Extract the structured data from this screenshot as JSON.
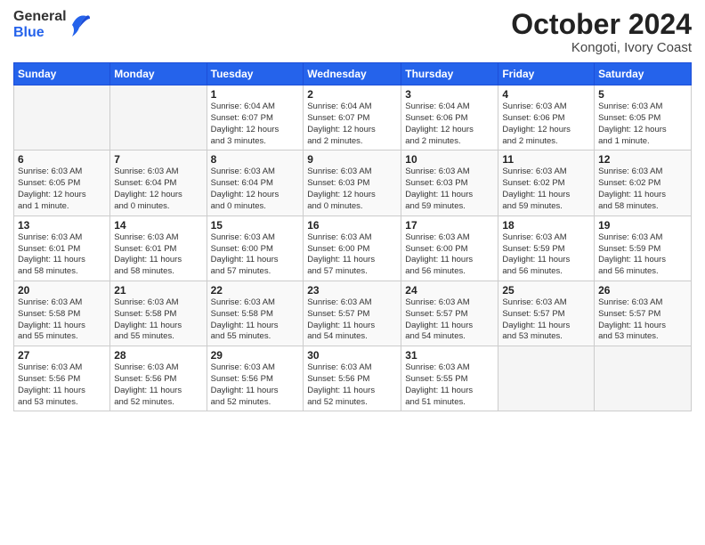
{
  "header": {
    "logo": {
      "general": "General",
      "blue": "Blue"
    },
    "title": "October 2024",
    "subtitle": "Kongoti, Ivory Coast"
  },
  "days_of_week": [
    "Sunday",
    "Monday",
    "Tuesday",
    "Wednesday",
    "Thursday",
    "Friday",
    "Saturday"
  ],
  "weeks": [
    [
      {
        "day": "",
        "info": ""
      },
      {
        "day": "",
        "info": ""
      },
      {
        "day": "1",
        "info": "Sunrise: 6:04 AM\nSunset: 6:07 PM\nDaylight: 12 hours\nand 3 minutes."
      },
      {
        "day": "2",
        "info": "Sunrise: 6:04 AM\nSunset: 6:07 PM\nDaylight: 12 hours\nand 2 minutes."
      },
      {
        "day": "3",
        "info": "Sunrise: 6:04 AM\nSunset: 6:06 PM\nDaylight: 12 hours\nand 2 minutes."
      },
      {
        "day": "4",
        "info": "Sunrise: 6:03 AM\nSunset: 6:06 PM\nDaylight: 12 hours\nand 2 minutes."
      },
      {
        "day": "5",
        "info": "Sunrise: 6:03 AM\nSunset: 6:05 PM\nDaylight: 12 hours\nand 1 minute."
      }
    ],
    [
      {
        "day": "6",
        "info": "Sunrise: 6:03 AM\nSunset: 6:05 PM\nDaylight: 12 hours\nand 1 minute."
      },
      {
        "day": "7",
        "info": "Sunrise: 6:03 AM\nSunset: 6:04 PM\nDaylight: 12 hours\nand 0 minutes."
      },
      {
        "day": "8",
        "info": "Sunrise: 6:03 AM\nSunset: 6:04 PM\nDaylight: 12 hours\nand 0 minutes."
      },
      {
        "day": "9",
        "info": "Sunrise: 6:03 AM\nSunset: 6:03 PM\nDaylight: 12 hours\nand 0 minutes."
      },
      {
        "day": "10",
        "info": "Sunrise: 6:03 AM\nSunset: 6:03 PM\nDaylight: 11 hours\nand 59 minutes."
      },
      {
        "day": "11",
        "info": "Sunrise: 6:03 AM\nSunset: 6:02 PM\nDaylight: 11 hours\nand 59 minutes."
      },
      {
        "day": "12",
        "info": "Sunrise: 6:03 AM\nSunset: 6:02 PM\nDaylight: 11 hours\nand 58 minutes."
      }
    ],
    [
      {
        "day": "13",
        "info": "Sunrise: 6:03 AM\nSunset: 6:01 PM\nDaylight: 11 hours\nand 58 minutes."
      },
      {
        "day": "14",
        "info": "Sunrise: 6:03 AM\nSunset: 6:01 PM\nDaylight: 11 hours\nand 58 minutes."
      },
      {
        "day": "15",
        "info": "Sunrise: 6:03 AM\nSunset: 6:00 PM\nDaylight: 11 hours\nand 57 minutes."
      },
      {
        "day": "16",
        "info": "Sunrise: 6:03 AM\nSunset: 6:00 PM\nDaylight: 11 hours\nand 57 minutes."
      },
      {
        "day": "17",
        "info": "Sunrise: 6:03 AM\nSunset: 6:00 PM\nDaylight: 11 hours\nand 56 minutes."
      },
      {
        "day": "18",
        "info": "Sunrise: 6:03 AM\nSunset: 5:59 PM\nDaylight: 11 hours\nand 56 minutes."
      },
      {
        "day": "19",
        "info": "Sunrise: 6:03 AM\nSunset: 5:59 PM\nDaylight: 11 hours\nand 56 minutes."
      }
    ],
    [
      {
        "day": "20",
        "info": "Sunrise: 6:03 AM\nSunset: 5:58 PM\nDaylight: 11 hours\nand 55 minutes."
      },
      {
        "day": "21",
        "info": "Sunrise: 6:03 AM\nSunset: 5:58 PM\nDaylight: 11 hours\nand 55 minutes."
      },
      {
        "day": "22",
        "info": "Sunrise: 6:03 AM\nSunset: 5:58 PM\nDaylight: 11 hours\nand 55 minutes."
      },
      {
        "day": "23",
        "info": "Sunrise: 6:03 AM\nSunset: 5:57 PM\nDaylight: 11 hours\nand 54 minutes."
      },
      {
        "day": "24",
        "info": "Sunrise: 6:03 AM\nSunset: 5:57 PM\nDaylight: 11 hours\nand 54 minutes."
      },
      {
        "day": "25",
        "info": "Sunrise: 6:03 AM\nSunset: 5:57 PM\nDaylight: 11 hours\nand 53 minutes."
      },
      {
        "day": "26",
        "info": "Sunrise: 6:03 AM\nSunset: 5:57 PM\nDaylight: 11 hours\nand 53 minutes."
      }
    ],
    [
      {
        "day": "27",
        "info": "Sunrise: 6:03 AM\nSunset: 5:56 PM\nDaylight: 11 hours\nand 53 minutes."
      },
      {
        "day": "28",
        "info": "Sunrise: 6:03 AM\nSunset: 5:56 PM\nDaylight: 11 hours\nand 52 minutes."
      },
      {
        "day": "29",
        "info": "Sunrise: 6:03 AM\nSunset: 5:56 PM\nDaylight: 11 hours\nand 52 minutes."
      },
      {
        "day": "30",
        "info": "Sunrise: 6:03 AM\nSunset: 5:56 PM\nDaylight: 11 hours\nand 52 minutes."
      },
      {
        "day": "31",
        "info": "Sunrise: 6:03 AM\nSunset: 5:55 PM\nDaylight: 11 hours\nand 51 minutes."
      },
      {
        "day": "",
        "info": ""
      },
      {
        "day": "",
        "info": ""
      }
    ]
  ]
}
